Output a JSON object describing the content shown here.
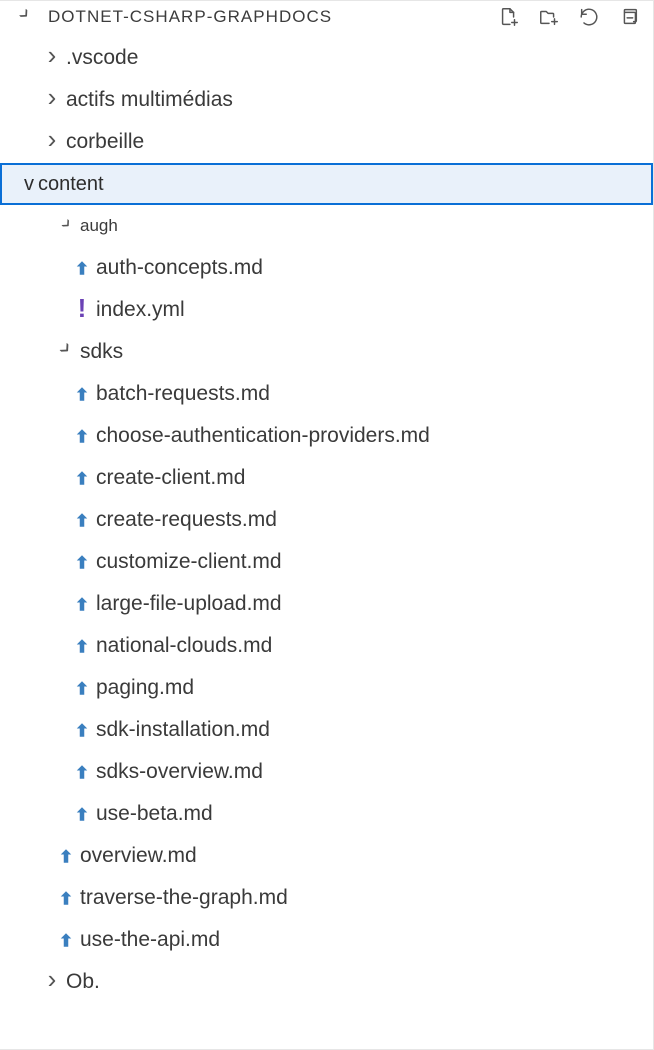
{
  "header": {
    "title": "DOTNET-CSHARP-GRAPHDOCS"
  },
  "tree": {
    "folders_top": [
      {
        "label": ".vscode"
      },
      {
        "label": "actifs multimédias"
      },
      {
        "label": "corbeille"
      }
    ],
    "selected_folder": {
      "label": "content"
    },
    "augh": {
      "label": "augh",
      "files": [
        {
          "label": "auth-concepts.md",
          "kind": "md"
        },
        {
          "label": "index.yml",
          "kind": "yml"
        }
      ]
    },
    "sdks": {
      "label": "sdks",
      "files": [
        {
          "label": "batch-requests.md",
          "kind": "md"
        },
        {
          "label": "choose-authentication-providers.md",
          "kind": "md"
        },
        {
          "label": "create-client.md",
          "kind": "md"
        },
        {
          "label": "create-requests.md",
          "kind": "md"
        },
        {
          "label": "customize-client.md",
          "kind": "md"
        },
        {
          "label": "large-file-upload.md",
          "kind": "md"
        },
        {
          "label": "national-clouds.md",
          "kind": "md"
        },
        {
          "label": "paging.md",
          "kind": "md"
        },
        {
          "label": "sdk-installation.md",
          "kind": "md"
        },
        {
          "label": "sdks-overview.md",
          "kind": "md"
        },
        {
          "label": "use-beta.md",
          "kind": "md"
        }
      ]
    },
    "content_files_after": [
      {
        "label": "overview.md",
        "kind": "md"
      },
      {
        "label": "traverse-the-graph.md",
        "kind": "md"
      },
      {
        "label": "use-the-api.md",
        "kind": "md"
      }
    ],
    "folder_after": {
      "label": "Ob."
    }
  }
}
